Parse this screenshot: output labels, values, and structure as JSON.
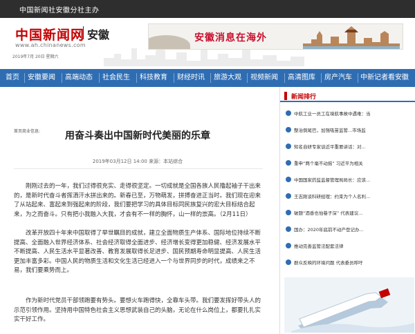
{
  "topbar": {
    "tagline": "中国新闻社安徽分社主办"
  },
  "header": {
    "logo": "中国新闻网",
    "region": "安徽",
    "url": "www.ah.chinanews.com",
    "date": "2019年7月 20日   星期六"
  },
  "banner": {
    "text": "安徽消息在海外"
  },
  "nav": {
    "items": [
      "首页",
      "安徽要闻",
      "高端动态",
      "社会民生",
      "科技教育",
      "财经时讯",
      "旅游大观",
      "视频新闻",
      "高清图库",
      "房产汽车",
      "中新记者看安徽"
    ]
  },
  "article": {
    "breadcrumb": "首页商业信息:",
    "title": "用奋斗奏出中国新时代美丽的乐章",
    "meta": "2019年03月12日  14:00    来源：本站综合",
    "paragraphs": [
      "刚刚过去的一年，我们过得很充实、走得很坚定。一切成就是全国各族人民撸起袖子干出来的，是新时代奋斗者挥洒汗水拼出来的。新春已至，万物萌发，拼搏奋进正当时。我们现在迎来了从站起来、富起来到强起来的阶段，我们要把学习的具体目标同民族复兴的宏大目标结合起来，为之而奋斗。只有把小我融入大我，才会有不一样的胸怀，山一样的崇高。（2月11日）",
      "改革开放四十年来中国取得了举世瞩目的成就，建立全面物质生产体系、国际地位持续不断提高、全面融入世界经济体系、社会经济取得全面进步、经济增长变得更加稳健、经济发展水平不断提高、人民生活水平显著改善、教育发展取得长足进步、国民预期寿命明显提高、人民生活更加丰富多彩。中国人民的物质生活和文化生活已经进入一个与世界同步的时代，成绩来之不易，我们要乘势而上。",
      "作为新时代党员干部领跑要有势头。要想火车跑得快，全靠车头带。我们要发挥好带头人的示范引领作用。坚持用中国特色社会主义思想武装自己的头脑，无论在什么岗位上，都要扎扎实实干好工作。"
    ]
  },
  "sidebar": {
    "heading": "新闻排行",
    "items": [
      "中航工业一员工在境航事故中遇难：当",
      "整治倒尾巴，加强吸苗监管...市场监",
      "知名自研专家谈近平重要讲话：对...",
      "重申“两个毫不动摇” 习近平为相关",
      "中国国家药监监督管理局局长：应该...",
      "王志刚谈科研经理：约束为个人名利...",
      "破题“酒香也怕巷子深” 代表建议...",
      "国办：2020年底前不动产登记办...",
      "推动完善监管法配套法律",
      "群众反映的环境问题 代表委员呼吁"
    ]
  },
  "colors": {
    "nav": "#2f6db2",
    "topbar": "#2e2e2e",
    "accent": "#c40000"
  }
}
